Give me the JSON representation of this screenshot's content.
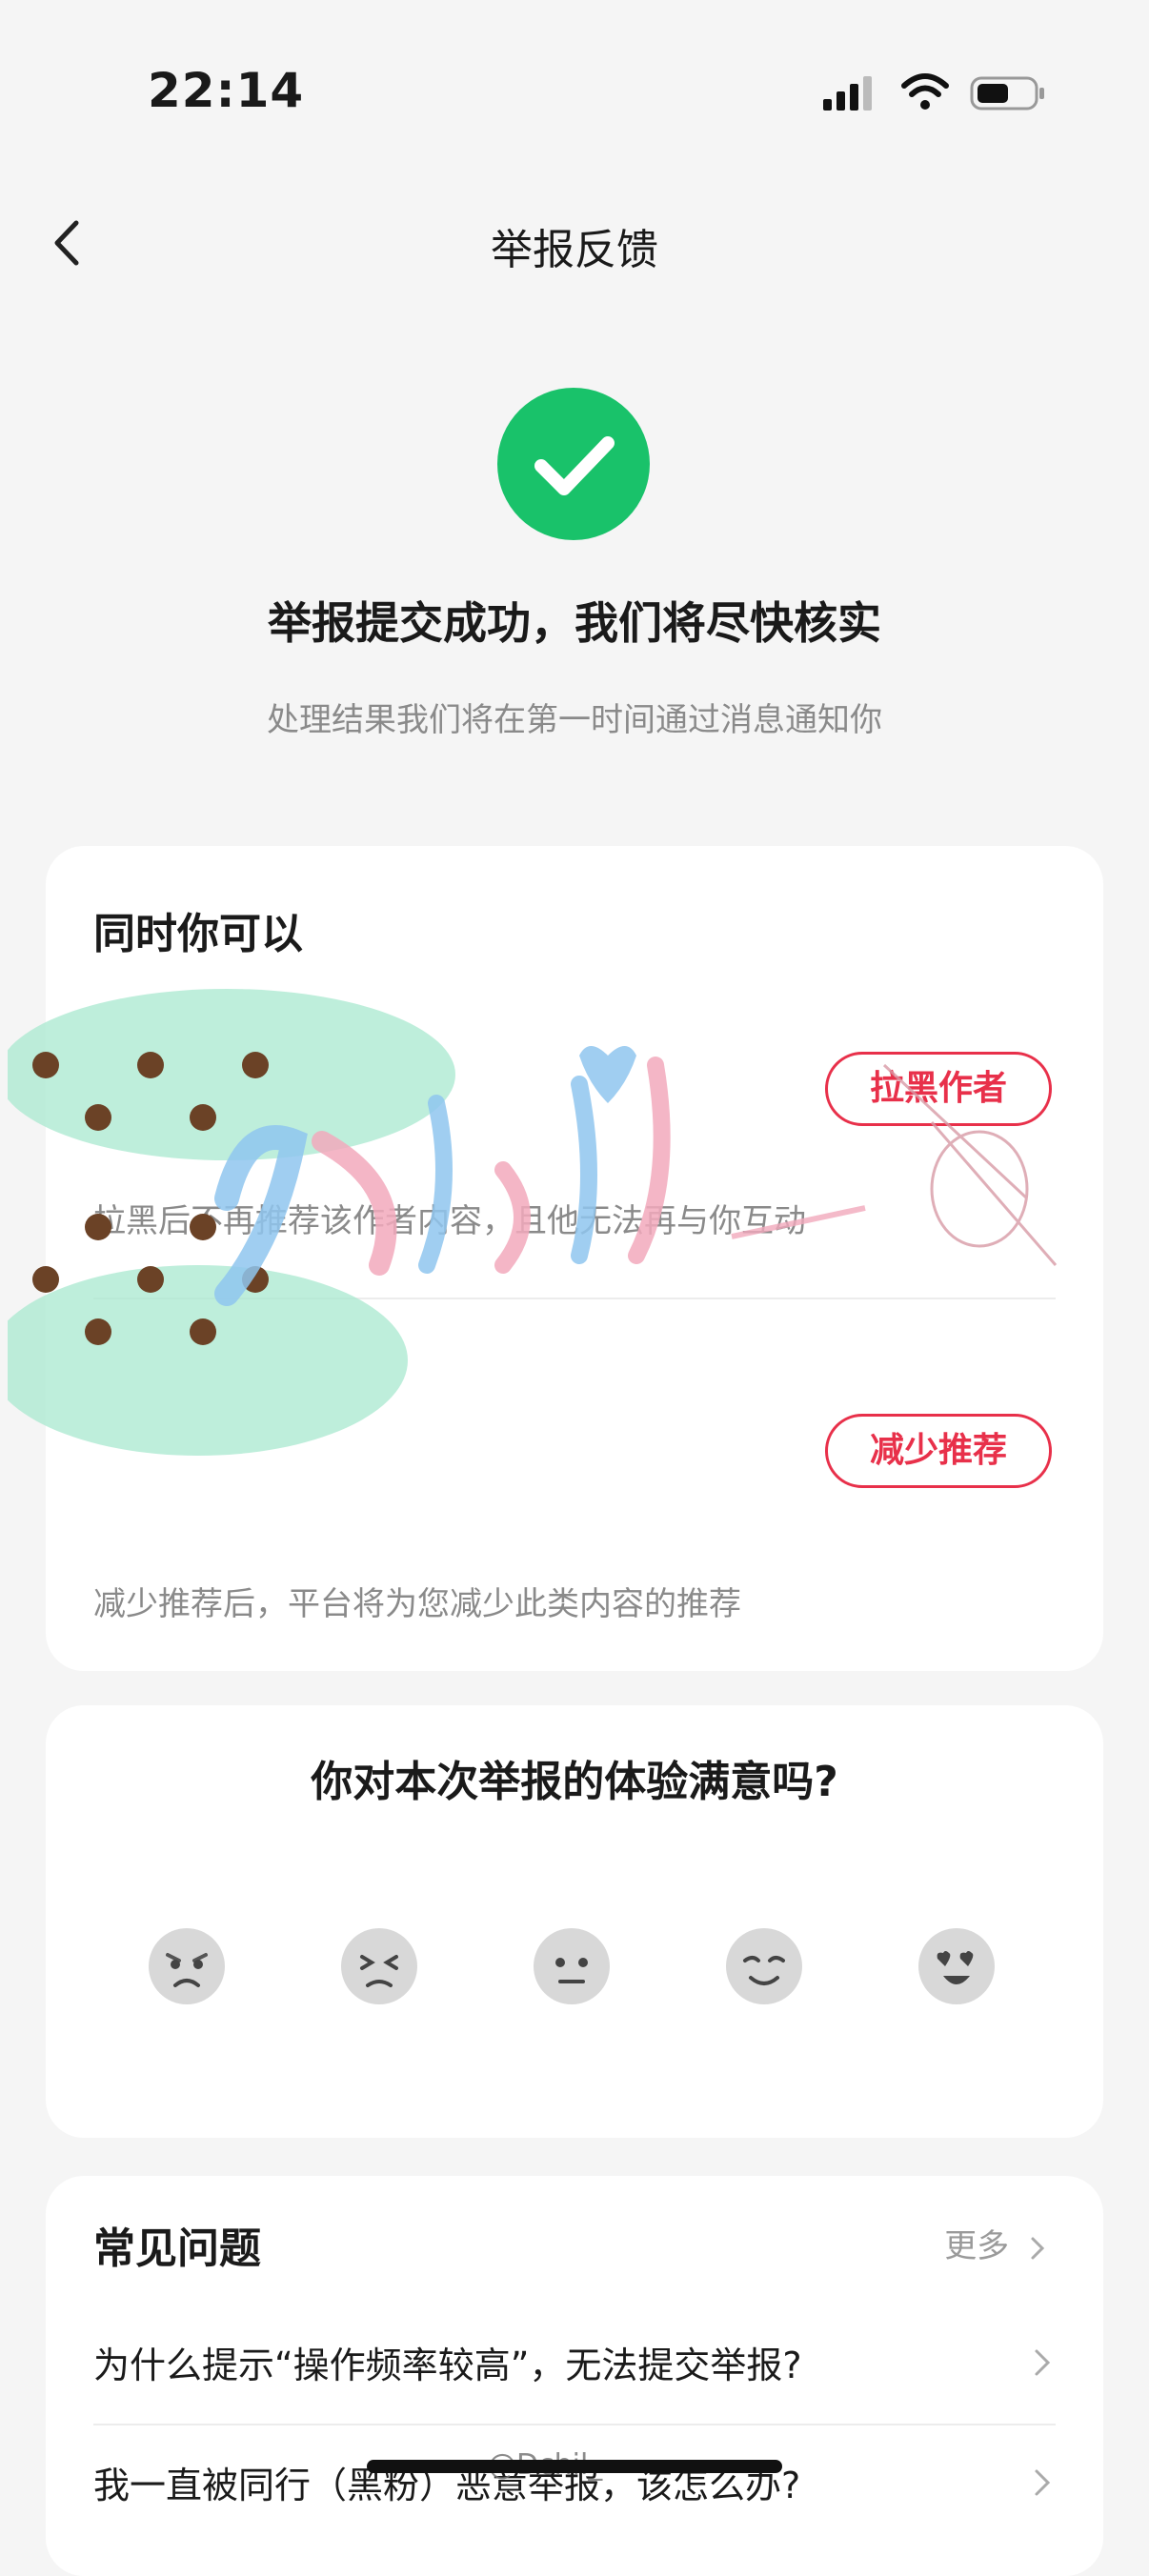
{
  "status_bar": {
    "time": "22:14"
  },
  "nav": {
    "title": "举报反馈"
  },
  "result": {
    "title": "举报提交成功，我们将尽快核实",
    "subtitle": "处理结果我们将在第一时间通过消息通知你"
  },
  "actions": {
    "title": "同时你可以",
    "items": [
      {
        "button": "拉黑作者",
        "desc": "拉黑后不再推荐该作者内容，且他无法再与你互动"
      },
      {
        "button": "减少推荐",
        "desc": "减少推荐后，平台将为您减少此类内容的推荐"
      }
    ]
  },
  "rating": {
    "title": "你对本次举报的体验满意吗?",
    "options": [
      "very-dissatisfied-icon",
      "dissatisfied-icon",
      "neutral-icon",
      "satisfied-icon",
      "very-satisfied-icon"
    ]
  },
  "faq": {
    "title": "常见问题",
    "more": "更多",
    "items": [
      "为什么提示“操作频率较高”，无法提交举报?",
      "我一直被同行（黑粉）恶意举报，该怎么办?"
    ]
  },
  "watermark": "@Dchil_",
  "colors": {
    "accent_red": "#e8304a",
    "success_green": "#19c26a",
    "background": "#f5f5f5"
  }
}
